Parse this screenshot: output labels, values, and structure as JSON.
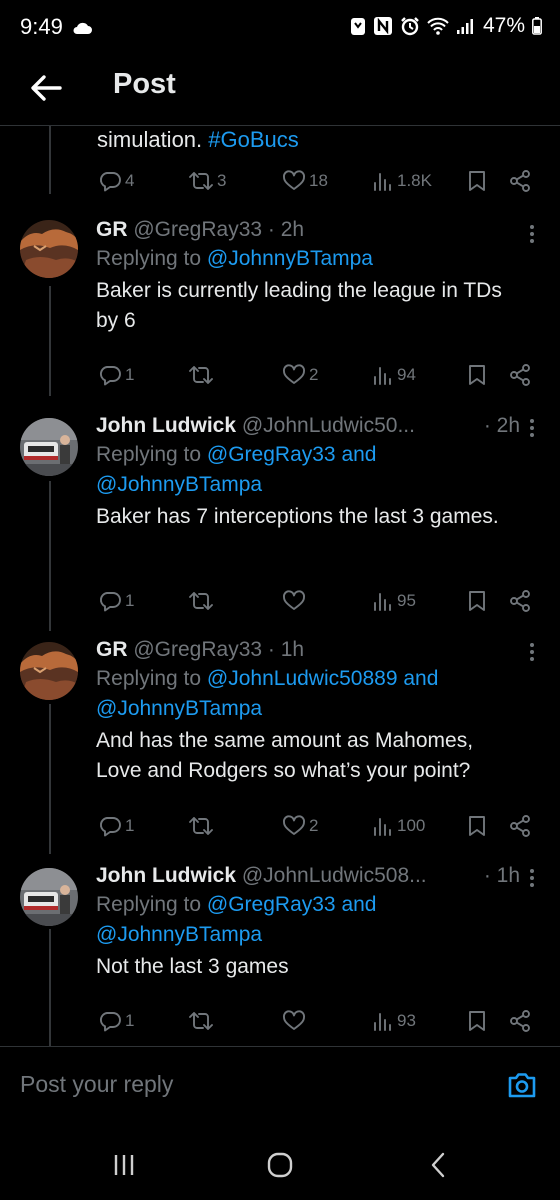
{
  "status_bar": {
    "time": "9:49",
    "battery": "47%"
  },
  "header": {
    "title": "Post"
  },
  "partial_post": {
    "text": "simulation.",
    "hashtag": "#GoBucs",
    "stats": {
      "replies": "4",
      "reposts": "3",
      "likes": "18",
      "views": "1.8K"
    }
  },
  "replies": [
    {
      "display_name": "GR",
      "handle": "@GregRay33 · 2h",
      "time": "",
      "replying_prefix": "Replying to",
      "replying_to": "@JohnnyBTampa",
      "replying_suffix": "",
      "text": "Baker is currently leading the league in TDs by 6",
      "stats": {
        "replies": "1",
        "reposts": "",
        "likes": "2",
        "views": "94"
      }
    },
    {
      "display_name": "John Ludwick",
      "handle": "@JohnLudwic50...",
      "time": "· 2h",
      "replying_prefix": "Replying to",
      "replying_to": "@GregRay33 and",
      "replying_suffix": "@JohnnyBTampa",
      "text": "Baker has 7 interceptions the last 3 games.",
      "stats": {
        "replies": "1",
        "reposts": "",
        "likes": "",
        "views": "95"
      }
    },
    {
      "display_name": "GR",
      "handle": "@GregRay33 · 1h",
      "time": "",
      "replying_prefix": "Replying to",
      "replying_to": "@JohnLudwic50889 and",
      "replying_suffix": "@JohnnyBTampa",
      "text": "And has the same amount as Mahomes, Love and Rodgers so what’s your point?",
      "stats": {
        "replies": "1",
        "reposts": "",
        "likes": "2",
        "views": "100"
      }
    },
    {
      "display_name": "John Ludwick",
      "handle": "@JohnLudwic508...",
      "time": "· 1h",
      "replying_prefix": "Replying to",
      "replying_to": "@GregRay33 and",
      "replying_suffix": "@JohnnyBTampa",
      "text": "Not the last 3 games",
      "stats": {
        "replies": "1",
        "reposts": "",
        "likes": "",
        "views": "93"
      }
    }
  ],
  "reply_bar": {
    "placeholder": "Post your reply"
  },
  "colors": {
    "accent": "#1d9bf0",
    "muted": "#71767b",
    "background": "#000000",
    "text": "#e7e9ea"
  },
  "icons": [
    "back-arrow-icon",
    "reply-icon",
    "repost-icon",
    "like-icon",
    "views-icon",
    "bookmark-icon",
    "share-icon",
    "more-icon",
    "camera-icon",
    "recents-icon",
    "home-icon",
    "back-nav-icon"
  ]
}
